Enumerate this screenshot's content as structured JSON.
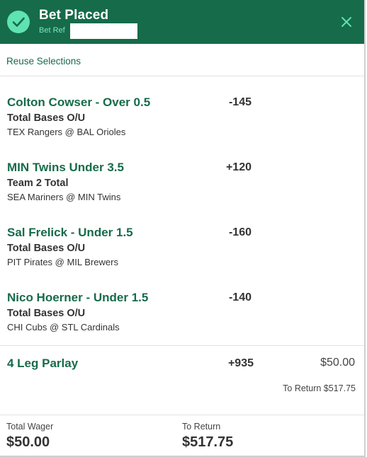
{
  "header": {
    "title": "Bet Placed",
    "bet_ref_label": "Bet Ref",
    "bet_ref_value": "",
    "bg_color": "#166b4a",
    "check_color": "#5fe3b0",
    "icons": {
      "status": "check-circle-icon",
      "close": "close-icon"
    }
  },
  "actions": {
    "reuse_label": "Reuse Selections"
  },
  "legs": [
    {
      "selection": "Colton Cowser - Over 0.5",
      "odds": "-145",
      "market": "Total Bases O/U",
      "event": "TEX Rangers @ BAL Orioles"
    },
    {
      "selection": "MIN Twins Under 3.5",
      "odds": "+120",
      "market": "Team 2 Total",
      "event": "SEA Mariners @ MIN Twins"
    },
    {
      "selection": "Sal Frelick - Under 1.5",
      "odds": "-160",
      "market": "Total Bases O/U",
      "event": "PIT Pirates @ MIL Brewers"
    },
    {
      "selection": "Nico Hoerner - Under 1.5",
      "odds": "-140",
      "market": "Total Bases O/U",
      "event": "CHI Cubs @ STL Cardinals"
    }
  ],
  "parlay": {
    "name": "4 Leg Parlay",
    "odds": "+935",
    "stake": "$50.00",
    "to_return": "To Return $517.75"
  },
  "footer": {
    "total_wager_label": "Total Wager",
    "total_wager_value": "$50.00",
    "to_return_label": "To Return",
    "to_return_value": "$517.75"
  }
}
